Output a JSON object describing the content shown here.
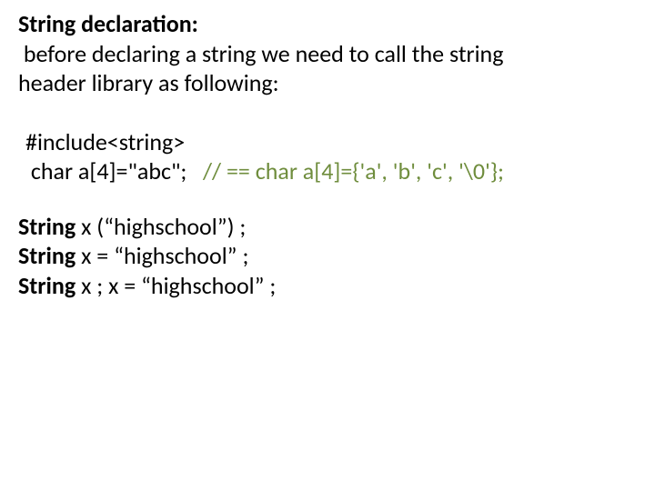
{
  "heading": "String declaration:",
  "intro_line1": " before declaring a string we need to call the string",
  "intro_line2": "header library as following:",
  "code": {
    "include": "#include<string>",
    "decl_part1": " char a[4]=\"abc\";",
    "decl_part2": "   // == char a[4]={'a', 'b', 'c', '\\0'};"
  },
  "examples": {
    "l1_bold": "String",
    "l1_rest": " x (“highschool”) ;",
    "l2_bold": "String",
    "l2_rest": " x = “highschool” ;",
    "l3_bold": "String",
    "l3_rest": " x ; x = “highschool” ;"
  }
}
